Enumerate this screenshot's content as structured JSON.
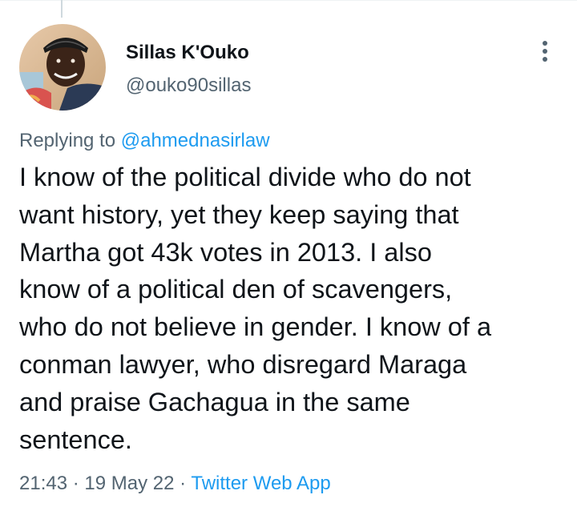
{
  "tweet": {
    "author": {
      "name": "Sillas K'Ouko",
      "handle": "@ouko90sillas"
    },
    "replying_prefix": "Replying to ",
    "replying_to": "@ahmednasirlaw",
    "text": "I know of the political divide who do not\nwant history, yet they keep saying that\nMartha got 43k votes in 2013. I also\nknow of a political den of scavengers,\nwho do not believe in gender. I know of a\nconman lawyer, who disregard Maraga\nand praise Gachagua in the same\nsentence.",
    "time": "21:43",
    "separator": " · ",
    "date": "19 May 22",
    "source": "Twitter Web App"
  },
  "icons": {
    "more": "more-vertical-icon",
    "avatar": "user-avatar-photo"
  },
  "colors": {
    "text_primary": "#0f1419",
    "text_secondary": "#536471",
    "accent": "#1d9bf0",
    "thread_line": "#cfd9de"
  }
}
